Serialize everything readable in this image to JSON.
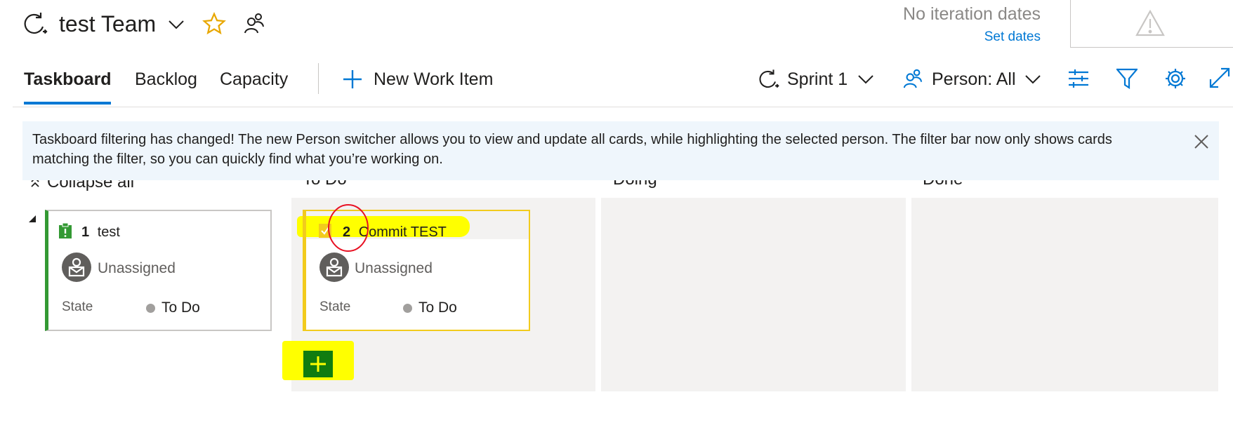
{
  "header": {
    "team_name": "test Team",
    "iteration_status": "No iteration dates",
    "set_dates_label": "Set dates"
  },
  "tabs": [
    {
      "label": "Taskboard",
      "selected": true
    },
    {
      "label": "Backlog",
      "selected": false
    },
    {
      "label": "Capacity",
      "selected": false
    }
  ],
  "toolbar": {
    "new_work_item_label": "New Work Item",
    "sprint_label": "Sprint 1",
    "person_label": "Person: All"
  },
  "banner": {
    "message": "Taskboard filtering has changed! The new Person switcher allows you to view and update all cards, while highlighting the selected person. The filter bar now only shows cards matching the filter, so you can quickly find what you’re working on."
  },
  "board": {
    "collapse_all_label": "Collapse all",
    "columns": [
      {
        "name": "To Do"
      },
      {
        "name": "Doing"
      },
      {
        "name": "Done"
      }
    ],
    "parent_card": {
      "id": "1",
      "title": "test",
      "assignee": "Unassigned",
      "state_label": "State",
      "state_value": "To Do",
      "accent_color": "#339933"
    },
    "task_card": {
      "id": "2",
      "title": "Commit TEST",
      "assignee": "Unassigned",
      "state_label": "State",
      "state_value": "To Do",
      "accent_color": "#f2cb1d"
    }
  },
  "colors": {
    "accent": "#0078d4",
    "highlight": "#ffff00",
    "annotation": "#e81123",
    "add_button": "#107c10"
  },
  "icons": [
    "sprint-icon",
    "chevron-down-icon",
    "star-icon",
    "team-people-icon",
    "warning-icon",
    "plus-icon",
    "person-icon",
    "settings-sliders-icon",
    "filter-icon",
    "gear-icon",
    "expand-icon",
    "close-icon",
    "collapse-icon",
    "expand-triangle-icon",
    "requirement-icon",
    "avatar-icon"
  ]
}
